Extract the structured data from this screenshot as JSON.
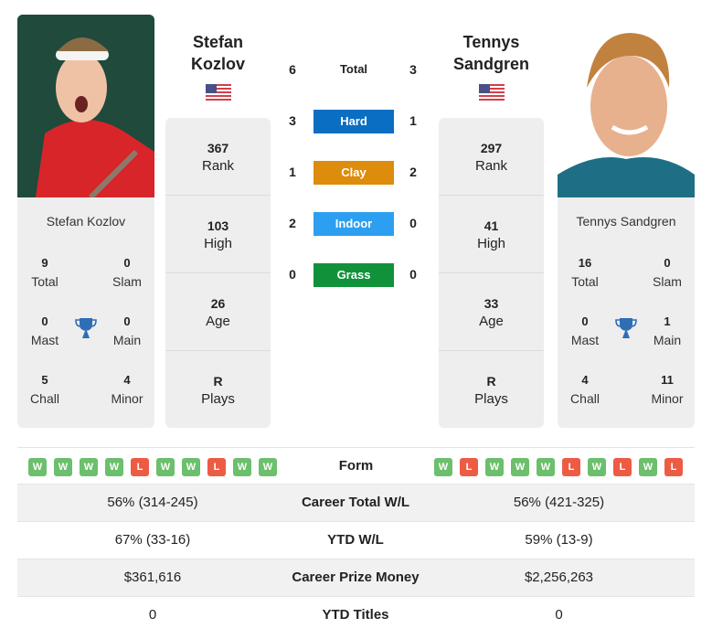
{
  "player1": {
    "name_line1": "Stefan",
    "name_line2": "Kozlov",
    "full_name": "Stefan Kozlov",
    "country_flag": "usa-flag",
    "titles": {
      "total": {
        "value": "9",
        "label": "Total"
      },
      "slam": {
        "value": "0",
        "label": "Slam"
      },
      "mast": {
        "value": "0",
        "label": "Mast"
      },
      "main": {
        "value": "0",
        "label": "Main"
      },
      "chall": {
        "value": "5",
        "label": "Chall"
      },
      "minor": {
        "value": "4",
        "label": "Minor"
      }
    },
    "rank": {
      "value": "367",
      "label": "Rank"
    },
    "high": {
      "value": "103",
      "label": "High"
    },
    "age": {
      "value": "26",
      "label": "Age"
    },
    "plays": {
      "value": "R",
      "label": "Plays"
    },
    "form": [
      "W",
      "W",
      "W",
      "W",
      "L",
      "W",
      "W",
      "L",
      "W",
      "W"
    ]
  },
  "player2": {
    "name_line1": "Tennys",
    "name_line2": "Sandgren",
    "full_name": "Tennys Sandgren",
    "country_flag": "usa-flag",
    "titles": {
      "total": {
        "value": "16",
        "label": "Total"
      },
      "slam": {
        "value": "0",
        "label": "Slam"
      },
      "mast": {
        "value": "0",
        "label": "Mast"
      },
      "main": {
        "value": "1",
        "label": "Main"
      },
      "chall": {
        "value": "4",
        "label": "Chall"
      },
      "minor": {
        "value": "11",
        "label": "Minor"
      }
    },
    "rank": {
      "value": "297",
      "label": "Rank"
    },
    "high": {
      "value": "41",
      "label": "High"
    },
    "age": {
      "value": "33",
      "label": "Age"
    },
    "plays": {
      "value": "R",
      "label": "Plays"
    },
    "form": [
      "W",
      "L",
      "W",
      "W",
      "W",
      "L",
      "W",
      "L",
      "W",
      "L"
    ]
  },
  "h2h": {
    "total": {
      "label": "Total",
      "p1": "6",
      "p2": "3"
    },
    "surfaces": [
      {
        "label": "Hard",
        "p1": "3",
        "p2": "1",
        "color": "#0a6ec2"
      },
      {
        "label": "Clay",
        "p1": "1",
        "p2": "2",
        "color": "#dd8c0b"
      },
      {
        "label": "Indoor",
        "p1": "2",
        "p2": "0",
        "color": "#2d9ff0"
      },
      {
        "label": "Grass",
        "p1": "0",
        "p2": "0",
        "color": "#11923a"
      }
    ]
  },
  "comparison": {
    "form_label": "Form",
    "rows": [
      {
        "label": "Career Total W/L",
        "p1": "56% (314-245)",
        "p2": "56% (421-325)"
      },
      {
        "label": "YTD W/L",
        "p1": "67% (33-16)",
        "p2": "59% (13-9)"
      },
      {
        "label": "Career Prize Money",
        "p1": "$361,616",
        "p2": "$2,256,263"
      },
      {
        "label": "YTD Titles",
        "p1": "0",
        "p2": "0"
      }
    ]
  }
}
